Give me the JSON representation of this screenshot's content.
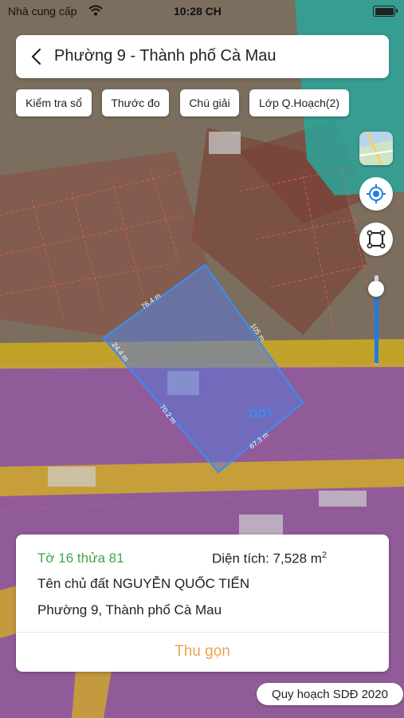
{
  "status_bar": {
    "carrier": "Nhà cung cấp",
    "time": "10:28 CH"
  },
  "header": {
    "title": "Phường 9 - Thành phố Cà Mau"
  },
  "chips": [
    "Kiểm tra sổ",
    "Thước đo",
    "Chú giải",
    "Lớp Q.Hoạch(2)"
  ],
  "map": {
    "zone_label": "ODT",
    "edge_labels": [
      "76.4 m",
      "24.4 m",
      "70.2 m",
      "67.3 m",
      "105 m"
    ],
    "opacity_slider_fraction": 0.85
  },
  "info_card": {
    "parcel": "Tờ 16 thửa 81",
    "area_label": "Diện tích: 7,528 m",
    "area_unit_sup": "2",
    "owner": "Tên chủ đất NGUYỄN QUỐC TIẾN",
    "address": "Phường 9, Thành phố Cà Mau",
    "collapse_label": "Thu gọn"
  },
  "plan_badge": "Quy hoạch SDĐ 2020",
  "colors": {
    "residential_purple": "#a855c8",
    "road_yellow": "#d8b51a",
    "water_teal": "#2ba69a",
    "parcel_blue": "#3a8ef5",
    "accent_orange": "#f0a050",
    "parcel_green": "#3fa64a"
  },
  "icons": [
    "wifi-icon",
    "battery-icon",
    "back-chevron-icon",
    "map-layer-icon",
    "locate-icon",
    "select-area-icon"
  ]
}
